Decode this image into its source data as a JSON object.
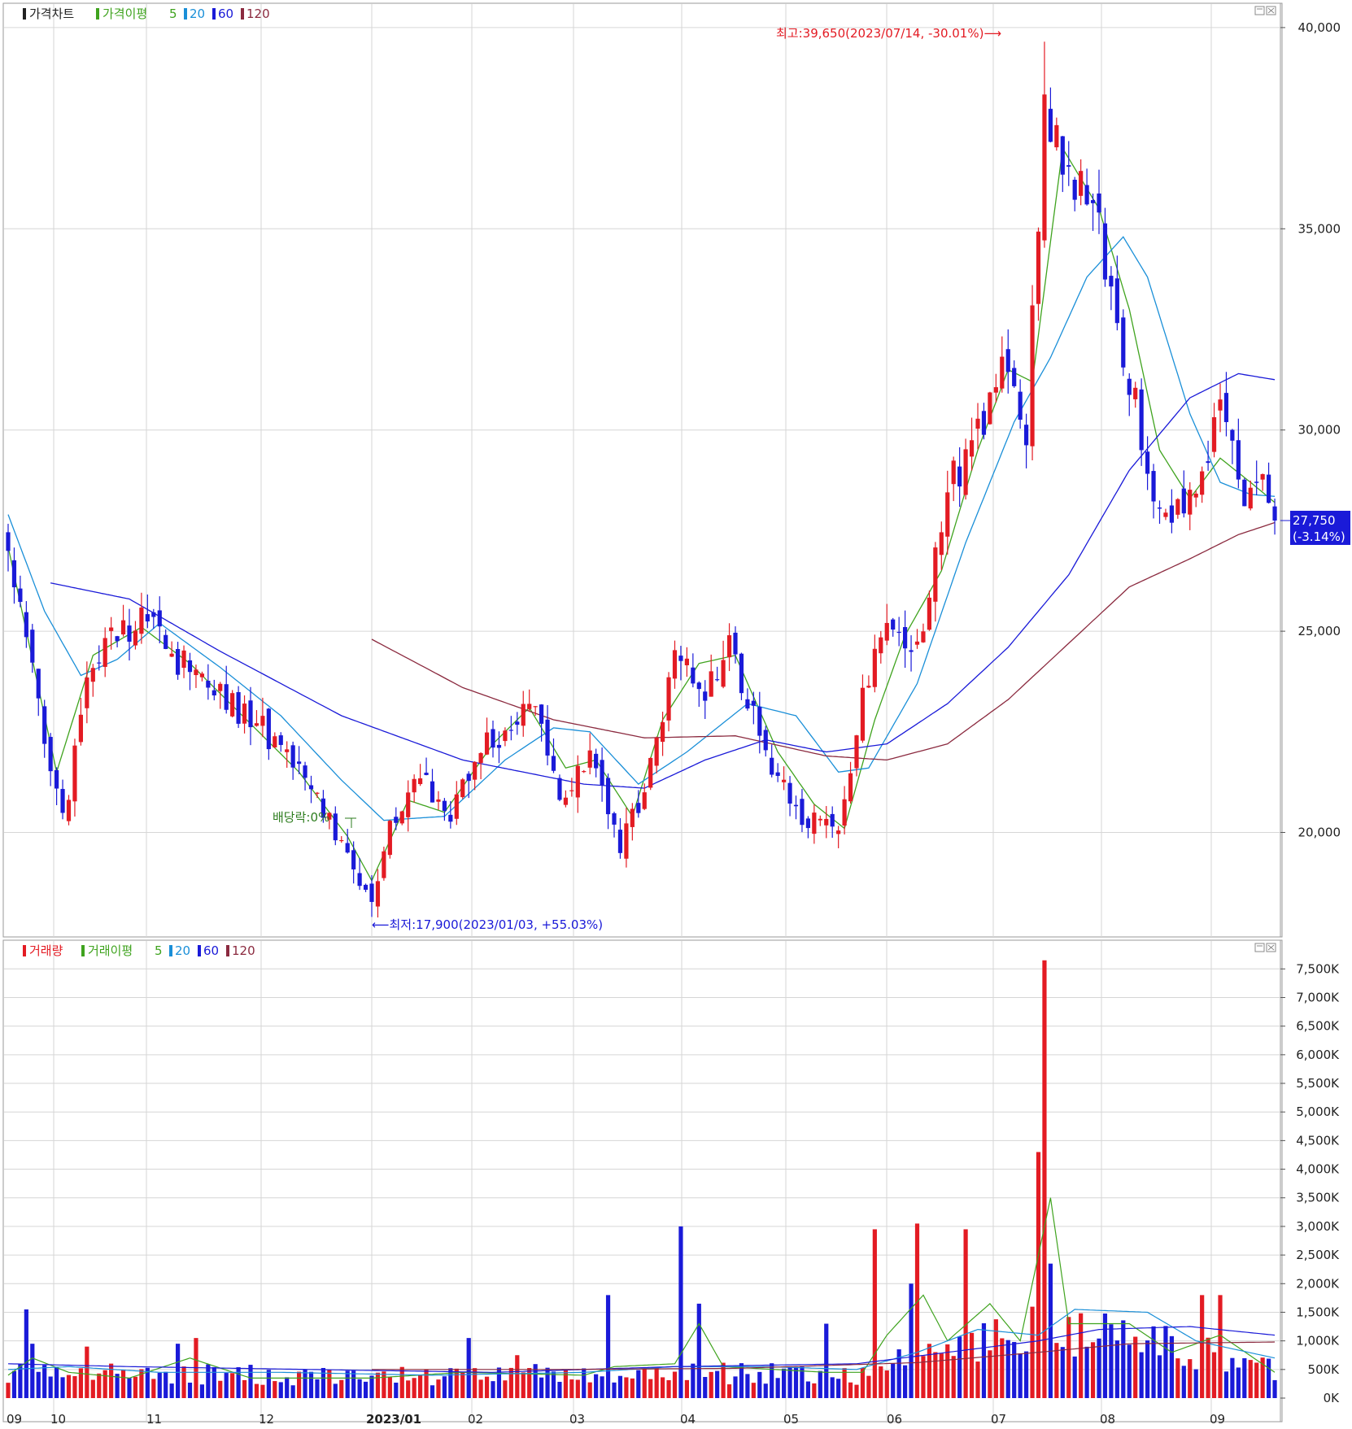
{
  "price_panel": {
    "legend": {
      "price_chart": "가격차트",
      "price_ma": "가격이평",
      "periods": [
        "5",
        "20",
        "60",
        "120"
      ]
    },
    "annotations": {
      "high": "최고:39,650(2023/07/14, -30.01%)⟶",
      "low": "⟵최저:17,900(2023/01/03, +55.03%)",
      "dividend": "배당락:0%"
    },
    "current": {
      "price": "27,750",
      "change": "(-3.14%)"
    }
  },
  "volume_panel": {
    "legend": {
      "volume": "거래량",
      "volume_ma": "거래이평",
      "periods": [
        "5",
        "20",
        "60",
        "120"
      ]
    }
  },
  "x_axis": {
    "labels": [
      "09",
      "10",
      "11",
      "12",
      "2023/01",
      "02",
      "03",
      "04",
      "05",
      "06",
      "07",
      "08",
      "09"
    ]
  },
  "colors": {
    "up": "#e31b23",
    "down": "#1a1ad8",
    "ma5": "#3fa31e",
    "ma20": "#1a8fd8",
    "ma60": "#1a1ad8",
    "ma120": "#8b2a3f",
    "grid": "#d6d6d6"
  },
  "chart_data": [
    {
      "type": "candlestick",
      "title": "가격차트",
      "y_ticks": [
        "20,000",
        "25,000",
        "30,000",
        "35,000",
        "40,000"
      ],
      "ylim": [
        17500,
        40500
      ],
      "months": [
        "2022-09",
        "2022-10",
        "2022-11",
        "2022-12",
        "2023-01",
        "2023-02",
        "2023-03",
        "2023-04",
        "2023-05",
        "2023-06",
        "2023-07",
        "2023-08",
        "2023-09"
      ],
      "high": {
        "value": 39650,
        "date": "2023/07/14",
        "change_to_current": "-30.01%"
      },
      "low": {
        "value": 17900,
        "date": "2023/01/03",
        "change_to_current": "+55.03%"
      },
      "last_close": 27750,
      "last_change": "-3.14%",
      "close_keypoints": [
        {
          "t": 0,
          "v": 27200
        },
        {
          "t": 4,
          "v": 24000
        },
        {
          "t": 9,
          "v": 20300
        },
        {
          "t": 14,
          "v": 24500
        },
        {
          "t": 22,
          "v": 25300
        },
        {
          "t": 30,
          "v": 24000
        },
        {
          "t": 42,
          "v": 22600
        },
        {
          "t": 50,
          "v": 21000
        },
        {
          "t": 56,
          "v": 19500
        },
        {
          "t": 60,
          "v": 18100
        },
        {
          "t": 63,
          "v": 20000
        },
        {
          "t": 68,
          "v": 21300
        },
        {
          "t": 73,
          "v": 20300
        },
        {
          "t": 78,
          "v": 22000
        },
        {
          "t": 86,
          "v": 23300
        },
        {
          "t": 91,
          "v": 21000
        },
        {
          "t": 96,
          "v": 22000
        },
        {
          "t": 101,
          "v": 19500
        },
        {
          "t": 106,
          "v": 21500
        },
        {
          "t": 110,
          "v": 24700
        },
        {
          "t": 115,
          "v": 23500
        },
        {
          "t": 119,
          "v": 24700
        },
        {
          "t": 126,
          "v": 21500
        },
        {
          "t": 132,
          "v": 20300
        },
        {
          "t": 137,
          "v": 20100
        },
        {
          "t": 141,
          "v": 23500
        },
        {
          "t": 146,
          "v": 25300
        },
        {
          "t": 150,
          "v": 24600
        },
        {
          "t": 155,
          "v": 28500
        },
        {
          "t": 160,
          "v": 29900
        },
        {
          "t": 165,
          "v": 32000
        },
        {
          "t": 168,
          "v": 30000
        },
        {
          "t": 171,
          "v": 38000
        },
        {
          "t": 174,
          "v": 36500
        },
        {
          "t": 179,
          "v": 35500
        },
        {
          "t": 184,
          "v": 32000
        },
        {
          "t": 189,
          "v": 28500
        },
        {
          "t": 193,
          "v": 28000
        },
        {
          "t": 197,
          "v": 28800
        },
        {
          "t": 200,
          "v": 30500
        },
        {
          "t": 204,
          "v": 28600
        },
        {
          "t": 207,
          "v": 28650
        },
        {
          "t": 209,
          "v": 27750
        }
      ],
      "ma_lines": [
        {
          "name": "5",
          "points": [
            {
              "t": 0,
              "v": 27100
            },
            {
              "t": 8,
              "v": 21500
            },
            {
              "t": 14,
              "v": 24400
            },
            {
              "t": 22,
              "v": 25100
            },
            {
              "t": 30,
              "v": 24200
            },
            {
              "t": 40,
              "v": 22700
            },
            {
              "t": 48,
              "v": 21500
            },
            {
              "t": 56,
              "v": 19900
            },
            {
              "t": 60,
              "v": 18800
            },
            {
              "t": 66,
              "v": 20800
            },
            {
              "t": 72,
              "v": 20500
            },
            {
              "t": 80,
              "v": 22200
            },
            {
              "t": 86,
              "v": 23100
            },
            {
              "t": 92,
              "v": 21600
            },
            {
              "t": 97,
              "v": 21800
            },
            {
              "t": 103,
              "v": 20400
            },
            {
              "t": 108,
              "v": 22800
            },
            {
              "t": 114,
              "v": 24200
            },
            {
              "t": 120,
              "v": 24400
            },
            {
              "t": 127,
              "v": 22000
            },
            {
              "t": 133,
              "v": 20700
            },
            {
              "t": 138,
              "v": 20100
            },
            {
              "t": 143,
              "v": 22800
            },
            {
              "t": 148,
              "v": 24900
            },
            {
              "t": 154,
              "v": 26500
            },
            {
              "t": 160,
              "v": 29500
            },
            {
              "t": 165,
              "v": 31500
            },
            {
              "t": 169,
              "v": 31200
            },
            {
              "t": 174,
              "v": 37000
            },
            {
              "t": 180,
              "v": 35500
            },
            {
              "t": 185,
              "v": 33000
            },
            {
              "t": 190,
              "v": 29500
            },
            {
              "t": 195,
              "v": 28300
            },
            {
              "t": 200,
              "v": 29300
            },
            {
              "t": 205,
              "v": 28700
            },
            {
              "t": 209,
              "v": 28200
            }
          ]
        },
        {
          "name": "20",
          "points": [
            {
              "t": 0,
              "v": 27900
            },
            {
              "t": 6,
              "v": 25500
            },
            {
              "t": 12,
              "v": 23900
            },
            {
              "t": 18,
              "v": 24300
            },
            {
              "t": 25,
              "v": 25200
            },
            {
              "t": 35,
              "v": 24100
            },
            {
              "t": 45,
              "v": 22900
            },
            {
              "t": 55,
              "v": 21300
            },
            {
              "t": 62,
              "v": 20300
            },
            {
              "t": 72,
              "v": 20400
            },
            {
              "t": 82,
              "v": 21800
            },
            {
              "t": 90,
              "v": 22600
            },
            {
              "t": 96,
              "v": 22500
            },
            {
              "t": 104,
              "v": 21200
            },
            {
              "t": 112,
              "v": 22000
            },
            {
              "t": 122,
              "v": 23200
            },
            {
              "t": 130,
              "v": 22900
            },
            {
              "t": 137,
              "v": 21500
            },
            {
              "t": 142,
              "v": 21600
            },
            {
              "t": 150,
              "v": 23700
            },
            {
              "t": 158,
              "v": 27200
            },
            {
              "t": 166,
              "v": 30200
            },
            {
              "t": 172,
              "v": 31800
            },
            {
              "t": 178,
              "v": 33800
            },
            {
              "t": 184,
              "v": 34800
            },
            {
              "t": 188,
              "v": 33800
            },
            {
              "t": 195,
              "v": 30400
            },
            {
              "t": 200,
              "v": 28700
            },
            {
              "t": 205,
              "v": 28400
            },
            {
              "t": 209,
              "v": 28350
            }
          ]
        },
        {
          "name": "60",
          "points": [
            {
              "t": 7,
              "v": 26200
            },
            {
              "t": 20,
              "v": 25800
            },
            {
              "t": 35,
              "v": 24500
            },
            {
              "t": 55,
              "v": 22900
            },
            {
              "t": 75,
              "v": 21800
            },
            {
              "t": 95,
              "v": 21200
            },
            {
              "t": 105,
              "v": 21100
            },
            {
              "t": 115,
              "v": 21800
            },
            {
              "t": 125,
              "v": 22300
            },
            {
              "t": 135,
              "v": 22000
            },
            {
              "t": 145,
              "v": 22200
            },
            {
              "t": 155,
              "v": 23200
            },
            {
              "t": 165,
              "v": 24600
            },
            {
              "t": 175,
              "v": 26400
            },
            {
              "t": 185,
              "v": 29000
            },
            {
              "t": 195,
              "v": 30800
            },
            {
              "t": 203,
              "v": 31400
            },
            {
              "t": 209,
              "v": 31250
            }
          ]
        },
        {
          "name": "120",
          "points": [
            {
              "t": 60,
              "v": 24800
            },
            {
              "t": 75,
              "v": 23600
            },
            {
              "t": 90,
              "v": 22800
            },
            {
              "t": 105,
              "v": 22350
            },
            {
              "t": 120,
              "v": 22400
            },
            {
              "t": 135,
              "v": 21900
            },
            {
              "t": 145,
              "v": 21800
            },
            {
              "t": 155,
              "v": 22200
            },
            {
              "t": 165,
              "v": 23300
            },
            {
              "t": 175,
              "v": 24700
            },
            {
              "t": 185,
              "v": 26100
            },
            {
              "t": 195,
              "v": 26800
            },
            {
              "t": 203,
              "v": 27400
            },
            {
              "t": 209,
              "v": 27700
            }
          ]
        }
      ]
    },
    {
      "type": "bar",
      "title": "거래량",
      "y_ticks": [
        "0K",
        "500K",
        "1,000K",
        "1,500K",
        "2,000K",
        "2,500K",
        "3,000K",
        "3,500K",
        "4,000K",
        "4,500K",
        "5,000K",
        "5,500K",
        "6,000K",
        "6,500K",
        "7,000K",
        "7,500K"
      ],
      "ylim": [
        0,
        7800
      ],
      "unit": "K",
      "peaks": [
        {
          "t": 3,
          "v": 1550
        },
        {
          "t": 4,
          "v": 950
        },
        {
          "t": 13,
          "v": 900
        },
        {
          "t": 28,
          "v": 950
        },
        {
          "t": 31,
          "v": 1050
        },
        {
          "t": 76,
          "v": 1050
        },
        {
          "t": 84,
          "v": 750
        },
        {
          "t": 99,
          "v": 1800
        },
        {
          "t": 111,
          "v": 3000
        },
        {
          "t": 114,
          "v": 1650
        },
        {
          "t": 135,
          "v": 1300
        },
        {
          "t": 143,
          "v": 2950
        },
        {
          "t": 149,
          "v": 2000
        },
        {
          "t": 150,
          "v": 3050
        },
        {
          "t": 158,
          "v": 2950
        },
        {
          "t": 171,
          "v": 7650
        },
        {
          "t": 170,
          "v": 4300
        },
        {
          "t": 172,
          "v": 2350
        },
        {
          "t": 197,
          "v": 1800
        },
        {
          "t": 200,
          "v": 1800
        }
      ],
      "ma_lines": [
        {
          "name": "5",
          "points": [
            {
              "t": 0,
              "v": 400
            },
            {
              "t": 4,
              "v": 700
            },
            {
              "t": 10,
              "v": 450
            },
            {
              "t": 20,
              "v": 350
            },
            {
              "t": 30,
              "v": 700
            },
            {
              "t": 40,
              "v": 350
            },
            {
              "t": 60,
              "v": 350
            },
            {
              "t": 75,
              "v": 450
            },
            {
              "t": 95,
              "v": 400
            },
            {
              "t": 100,
              "v": 550
            },
            {
              "t": 110,
              "v": 600
            },
            {
              "t": 114,
              "v": 1300
            },
            {
              "t": 118,
              "v": 550
            },
            {
              "t": 135,
              "v": 450
            },
            {
              "t": 141,
              "v": 450
            },
            {
              "t": 145,
              "v": 1100
            },
            {
              "t": 151,
              "v": 1800
            },
            {
              "t": 155,
              "v": 1000
            },
            {
              "t": 162,
              "v": 1650
            },
            {
              "t": 167,
              "v": 1000
            },
            {
              "t": 172,
              "v": 3500
            },
            {
              "t": 175,
              "v": 1300
            },
            {
              "t": 185,
              "v": 1300
            },
            {
              "t": 192,
              "v": 800
            },
            {
              "t": 200,
              "v": 1100
            },
            {
              "t": 209,
              "v": 450
            }
          ]
        },
        {
          "name": "20",
          "points": [
            {
              "t": 0,
              "v": 500
            },
            {
              "t": 10,
              "v": 550
            },
            {
              "t": 25,
              "v": 450
            },
            {
              "t": 45,
              "v": 450
            },
            {
              "t": 70,
              "v": 400
            },
            {
              "t": 95,
              "v": 450
            },
            {
              "t": 110,
              "v": 550
            },
            {
              "t": 125,
              "v": 550
            },
            {
              "t": 140,
              "v": 500
            },
            {
              "t": 150,
              "v": 800
            },
            {
              "t": 160,
              "v": 1200
            },
            {
              "t": 170,
              "v": 1100
            },
            {
              "t": 176,
              "v": 1550
            },
            {
              "t": 188,
              "v": 1500
            },
            {
              "t": 196,
              "v": 1000
            },
            {
              "t": 209,
              "v": 700
            }
          ]
        },
        {
          "name": "60",
          "points": [
            {
              "t": 0,
              "v": 600
            },
            {
              "t": 20,
              "v": 550
            },
            {
              "t": 50,
              "v": 500
            },
            {
              "t": 80,
              "v": 450
            },
            {
              "t": 110,
              "v": 550
            },
            {
              "t": 140,
              "v": 600
            },
            {
              "t": 155,
              "v": 800
            },
            {
              "t": 170,
              "v": 1000
            },
            {
              "t": 180,
              "v": 1200
            },
            {
              "t": 195,
              "v": 1250
            },
            {
              "t": 209,
              "v": 1100
            }
          ]
        },
        {
          "name": "120",
          "points": [
            {
              "t": 60,
              "v": 500
            },
            {
              "t": 90,
              "v": 500
            },
            {
              "t": 120,
              "v": 520
            },
            {
              "t": 150,
              "v": 620
            },
            {
              "t": 170,
              "v": 800
            },
            {
              "t": 185,
              "v": 950
            },
            {
              "t": 209,
              "v": 980
            }
          ]
        }
      ]
    }
  ]
}
